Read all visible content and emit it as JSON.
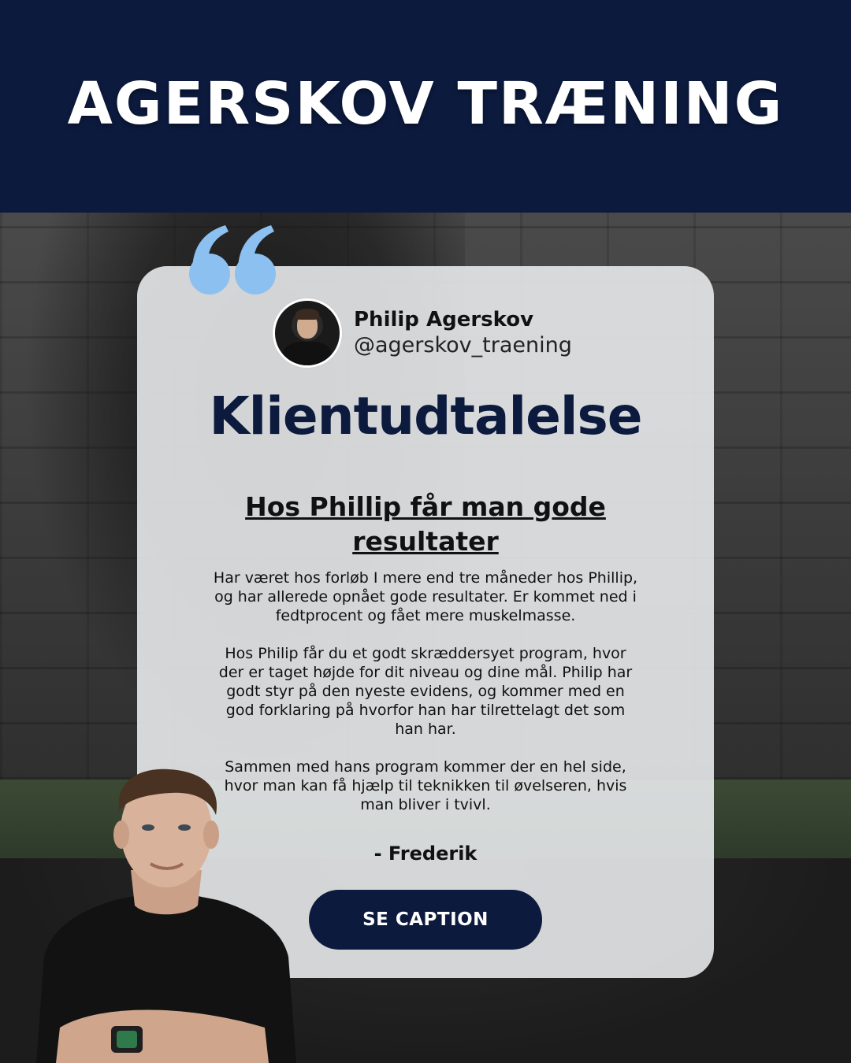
{
  "header": {
    "title": "AGERSKOV TRÆNING"
  },
  "profile": {
    "name": "Philip Agerskov",
    "handle": "@agerskov_traening"
  },
  "card": {
    "heading": "Klientudtalelse",
    "subheading": "Hos Phillip får man gode resultater",
    "paragraphs": [
      "Har været hos forløb I mere end tre måneder hos Phillip, og har allerede opnået gode resultater. Er kommet ned i fedtprocent og fået mere muskelmasse.",
      "Hos Philip får du et godt skræddersyet program, hvor der er taget højde for dit niveau og dine mål. Philip har godt styr på den nyeste evidens, og kommer med en god forklaring på hvorfor han har tilrettelagt det som han har.",
      "Sammen med hans program kommer der en hel side, hvor man kan få hjælp til teknikken til øvelseren, hvis man bliver i tvivl."
    ],
    "signature": "- Frederik",
    "cta_label": "SE CAPTION"
  },
  "colors": {
    "navy": "#0c1a3e",
    "quote_blue": "#8cc0f0",
    "card_bg": "#eceef0"
  },
  "icons": {
    "quote": "quote-icon"
  }
}
